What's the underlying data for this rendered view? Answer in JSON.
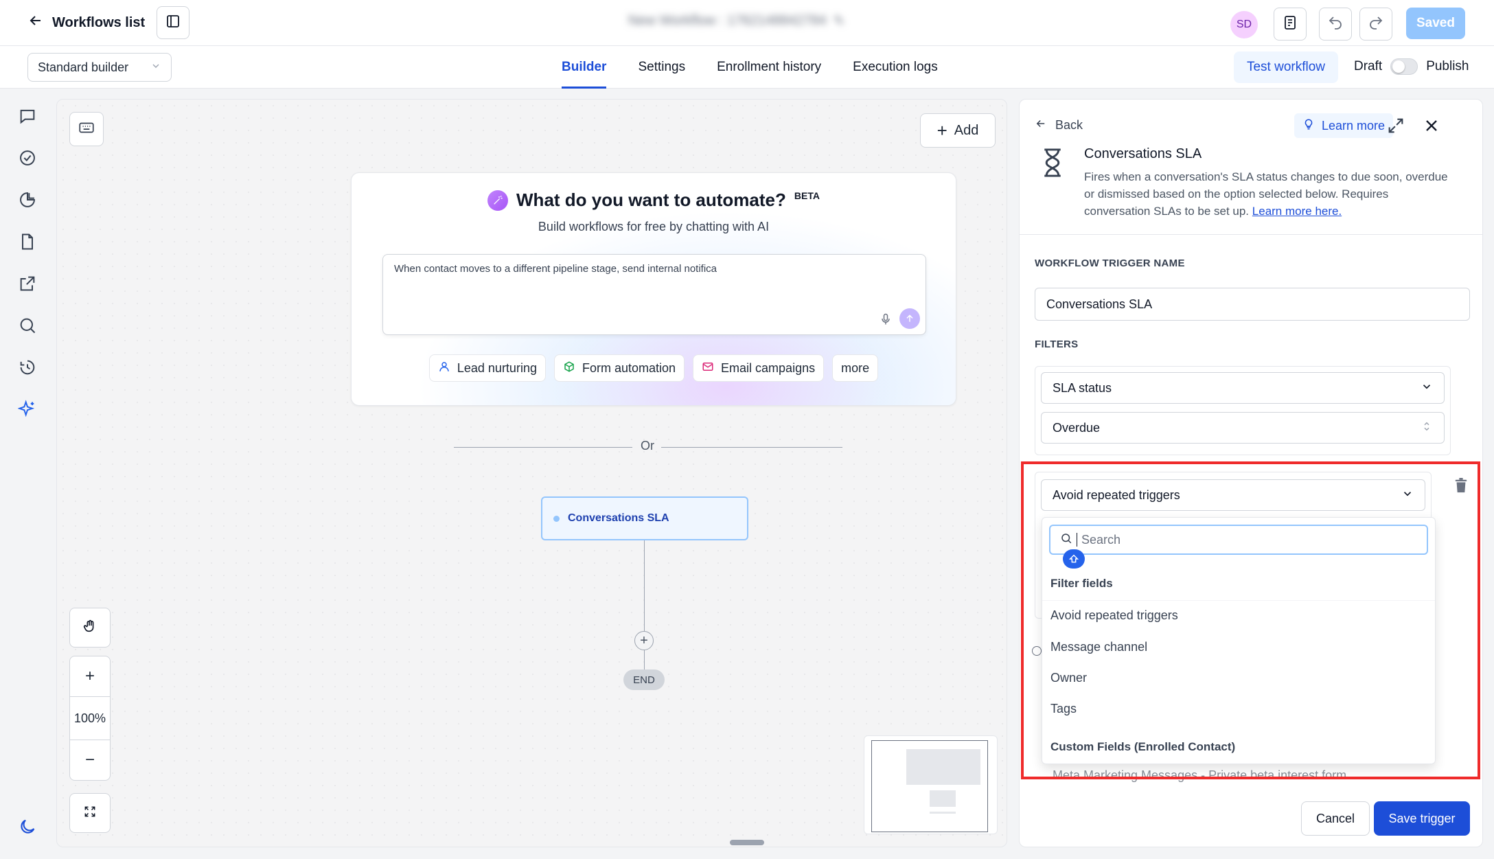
{
  "topbar": {
    "back_label": "Workflows list",
    "workflow_title": "New Workflow : 1762148842784",
    "avatar_initials": "SD",
    "saved_label": "Saved"
  },
  "subbar": {
    "builder_mode": "Standard builder",
    "tabs": [
      {
        "label": "Builder",
        "active": true
      },
      {
        "label": "Settings",
        "active": false
      },
      {
        "label": "Enrollment history",
        "active": false
      },
      {
        "label": "Execution logs",
        "active": false
      }
    ],
    "test_label": "Test workflow",
    "draft_label": "Draft",
    "publish_label": "Publish"
  },
  "canvas": {
    "add_label": "Add",
    "ai": {
      "title": "What do you want to automate?",
      "beta": "BETA",
      "subtitle": "Build workflows for free by chatting with AI",
      "input_value": "When contact moves to a different pipeline stage, send internal notifica",
      "chips": [
        "Lead nurturing",
        "Form automation",
        "Email campaigns",
        "more"
      ]
    },
    "or_label": "Or",
    "trigger_node_label": "Conversations SLA",
    "end_label": "END",
    "zoom_level": "100%"
  },
  "panel": {
    "back_label": "Back",
    "learn_more_label": "Learn more",
    "title": "Conversations SLA",
    "description": "Fires when a conversation's SLA status changes to due soon, overdue or dismissed based on the option selected below. Requires conversation SLAs to be set up.",
    "description_link": "Learn more here.",
    "trigger_name_label": "WORKFLOW TRIGGER NAME",
    "trigger_name_value": "Conversations SLA",
    "filters_label": "FILTERS",
    "filter1_field": "SLA status",
    "filter1_value": "Overdue",
    "filter2_field": "Avoid repeated triggers",
    "dropdown": {
      "search_placeholder": "Search",
      "group1": "Filter fields",
      "items": [
        "Avoid repeated triggers",
        "Message channel",
        "Owner",
        "Tags"
      ],
      "group2": "Custom Fields (Enrolled Contact)",
      "cut_item": "Meta Marketing Messages - Private beta interest form"
    },
    "cancel_label": "Cancel",
    "save_label": "Save trigger"
  },
  "colors": {
    "accent": "#1d4ed8",
    "highlight": "#ef2b2b"
  }
}
